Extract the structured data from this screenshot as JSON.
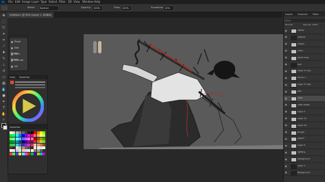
{
  "app": {
    "logo": "Ps"
  },
  "menu": [
    "File",
    "Edit",
    "Image",
    "Layer",
    "Type",
    "Select",
    "Filter",
    "3D",
    "View",
    "Window",
    "Help"
  ],
  "options": {
    "mode_label": "Mode:",
    "mode_value": "Normal",
    "opacity_label": "Opacity:",
    "opacity_value": "100%",
    "flow_label": "Flow:",
    "flow_value": "100%",
    "smoothing_label": "Smoothing:",
    "smoothing_value": "10%"
  },
  "document_tab": {
    "label": "Untitled-1 @ 50% (Layer 1, RGB/8)"
  },
  "brush_panel": {
    "items": [
      "Pencil",
      "Soft Round",
      "Hard Round",
      "Airbrush",
      "Ink"
    ]
  },
  "color_panel": {
    "tabs": [
      "Color",
      "Swatches"
    ]
  },
  "swatch_panel": {
    "title": "Swatches",
    "colors": [
      "#ffffff",
      "#d9d9d9",
      "#b3b3b3",
      "#8c8c8c",
      "#666666",
      "#404040",
      "#1a1a1a",
      "#000000",
      "#ff0000",
      "#ff8000",
      "#ffff00",
      "#80ff00",
      "#00ff00",
      "#00ff80",
      "#00ffff",
      "#0080ff",
      "#0000ff",
      "#8000ff",
      "#ff00ff",
      "#ff0080",
      "#ff6666",
      "#ffb366",
      "#ffff66",
      "#b3ff66",
      "#66ff66",
      "#66ffb3",
      "#66ffff",
      "#66b3ff",
      "#6666ff",
      "#b366ff",
      "#ff66ff",
      "#ff66b3",
      "#990000",
      "#994d00",
      "#999900",
      "#4d9900",
      "#009900",
      "#00994d",
      "#009999",
      "#004d99",
      "#000099",
      "#4d0099",
      "#990099",
      "#99004d",
      "#cc3333",
      "#cc8033",
      "#cccc33",
      "#80cc33",
      "#33cc33",
      "#33cc80",
      "#33cccc",
      "#3380cc",
      "#3333cc",
      "#8033cc",
      "#cc33cc",
      "#cc3380",
      "#f2c2a0",
      "#e8a070",
      "#c67a4a",
      "#8a5232",
      "#5a3420",
      "#3b2418",
      "#f0e0d0",
      "#d8c0a8",
      "#b09070",
      "#806040",
      "#604830",
      "#402818",
      "#ffe0e0",
      "#e0ffe0",
      "#e0e0ff",
      "#ffffe0",
      "#e0ffff",
      "#ffe0ff",
      "#c0c0ff",
      "#c0ffc0",
      "#ffc0c0",
      "#ffc0ff",
      "#c0ffff",
      "#ffffc0",
      "#808080",
      "#a0a0a0",
      "#606060",
      "#303030",
      "#ff4040",
      "#40ff40",
      "#4040ff",
      "#ffff40",
      "#40ffff",
      "#ff40ff",
      "#c04000",
      "#00c040",
      "#4000c0",
      "#c0c000",
      "#00c0c0",
      "#c000c0"
    ]
  },
  "layers_panel": {
    "tabs": [
      "Layers",
      "Channels",
      "Paths"
    ],
    "filter_label": "Kind",
    "blend_label": "Normal",
    "opacity_label": "Opacity: 100%",
    "layers": [
      {
        "name": "spikes",
        "selected": false,
        "dark": false
      },
      {
        "name": "shadow",
        "selected": false,
        "dark": true
      },
      {
        "name": "lineart",
        "selected": false,
        "dark": false
      },
      {
        "name": "chain",
        "selected": false,
        "dark": false
      },
      {
        "name": "blood lines",
        "selected": false,
        "dark": false
      },
      {
        "name": "hair",
        "selected": false,
        "dark": true
      },
      {
        "name": "Layer 4 copy",
        "selected": false,
        "dark": false
      },
      {
        "name": "Group 1",
        "selected": false,
        "dark": false
      },
      {
        "name": "Layer 3 copy",
        "selected": false,
        "dark": false
      },
      {
        "name": "skin",
        "selected": false,
        "dark": false
      },
      {
        "name": "cloth",
        "selected": true,
        "dark": false
      },
      {
        "name": "cloth shade",
        "selected": false,
        "dark": false
      },
      {
        "name": "Layer 2",
        "selected": false,
        "dark": false
      },
      {
        "name": "Layer 11",
        "selected": false,
        "dark": false
      },
      {
        "name": "Layer 10",
        "selected": false,
        "dark": false
      },
      {
        "name": "Rough",
        "selected": false,
        "dark": false
      },
      {
        "name": "sketch",
        "selected": false,
        "dark": false
      },
      {
        "name": "Layer 5",
        "selected": false,
        "dark": false
      },
      {
        "name": "lighting",
        "selected": false,
        "dark": false
      },
      {
        "name": "background",
        "selected": false,
        "dark": false
      },
      {
        "name": "Layer 1",
        "selected": false,
        "dark": true
      },
      {
        "name": "Background",
        "selected": false,
        "dark": true
      }
    ]
  },
  "colors": {
    "canvas": "#5a5a5a",
    "blood": "#a0322d",
    "lineart": "#141414"
  }
}
